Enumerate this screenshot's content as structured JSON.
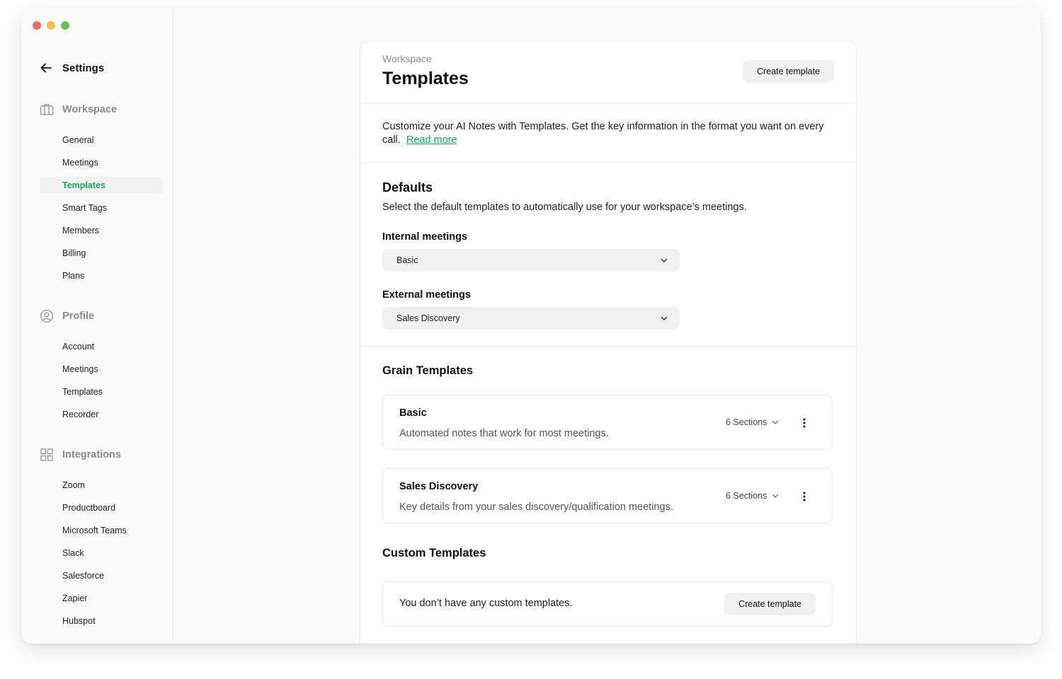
{
  "sidebar": {
    "back_label": "Settings",
    "groups": [
      {
        "title": "Workspace",
        "icon": "briefcase-icon",
        "items": [
          "General",
          "Meetings",
          "Templates",
          "Smart Tags",
          "Members",
          "Billing",
          "Plans"
        ]
      },
      {
        "title": "Profile",
        "icon": "user-circle-icon",
        "items": [
          "Account",
          "Meetings",
          "Templates",
          "Recorder"
        ]
      },
      {
        "title": "Integrations",
        "icon": "grid-icon",
        "items": [
          "Zoom",
          "Productboard",
          "Microsoft Teams",
          "Slack",
          "Salesforce",
          "Zapier",
          "Hubspot"
        ]
      }
    ],
    "active_item": "Templates"
  },
  "header": {
    "breadcrumb": "Workspace",
    "title": "Templates",
    "create_button": "Create template"
  },
  "intro": {
    "text": "Customize your AI Notes with Templates. Get the key information in the format you want on every call.",
    "read_more": "Read more"
  },
  "defaults": {
    "title": "Defaults",
    "description": "Select the default templates to automatically use for your workspace’s meetings.",
    "internal_label": "Internal meetings",
    "internal_value": "Basic",
    "external_label": "External meetings",
    "external_value": "Sales Discovery"
  },
  "grain_templates": {
    "title": "Grain Templates",
    "items": [
      {
        "name": "Basic",
        "description": "Automated notes that work for most meetings.",
        "sections": "6 Sections"
      },
      {
        "name": "Sales Discovery",
        "description": "Key details from your sales discovery/qualification meetings.",
        "sections": "6 Sections"
      }
    ]
  },
  "custom_templates": {
    "title": "Custom Templates",
    "empty_text": "You don’t have any custom templates.",
    "create_button": "Create template"
  },
  "colors": {
    "accent": "#1aa45c",
    "traffic_red": "#ec6a5e",
    "traffic_yellow": "#f4bf4f",
    "traffic_green": "#61c554"
  }
}
